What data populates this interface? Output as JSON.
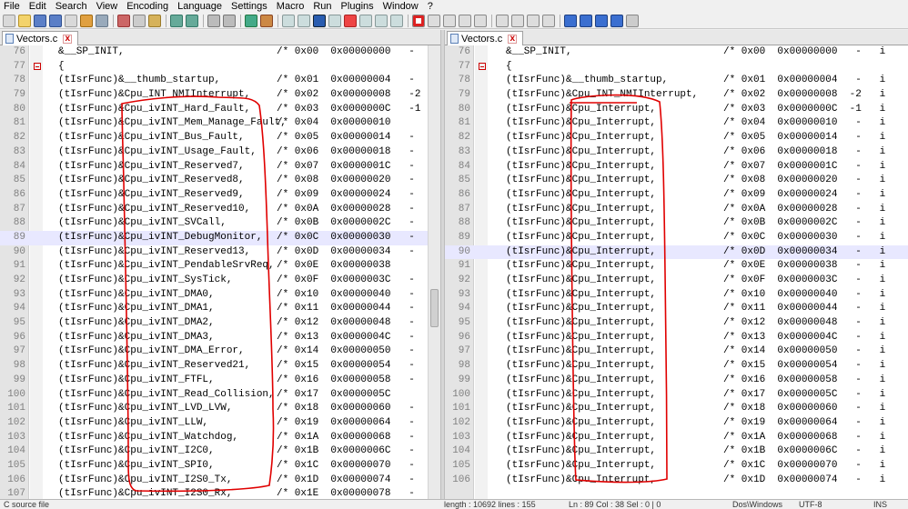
{
  "menu": [
    "File",
    "Edit",
    "Search",
    "View",
    "Encoding",
    "Language",
    "Settings",
    "Macro",
    "Run",
    "Plugins",
    "Window",
    "?"
  ],
  "tabs": {
    "left": "Vectors.c",
    "right": "Vectors.c"
  },
  "left_lines": [
    {
      "n": "76",
      "fold": false,
      "hl": false,
      "pre": "&__SP_INIT,",
      "cm": "/* 0x00  0x00000000   -"
    },
    {
      "n": "77",
      "fold": true,
      "hl": false,
      "pre": "{",
      "cm": ""
    },
    {
      "n": "78",
      "fold": false,
      "hl": false,
      "pre": "(tIsrFunc)&__thumb_startup,",
      "cm": "/* 0x01  0x00000004   -"
    },
    {
      "n": "79",
      "fold": false,
      "hl": false,
      "pre": "(tIsrFunc)&Cpu_INT_NMIInterrupt,",
      "cm": "/* 0x02  0x00000008   -2"
    },
    {
      "n": "80",
      "fold": false,
      "hl": false,
      "pre": "(tIsrFunc)&Cpu_ivINT_Hard_Fault,",
      "cm": "/* 0x03  0x0000000C   -1"
    },
    {
      "n": "81",
      "fold": false,
      "hl": false,
      "pre": "(tIsrFunc)&Cpu_ivINT_Mem_Manage_Fault,",
      "cm": "/* 0x04  0x00000010"
    },
    {
      "n": "82",
      "fold": false,
      "hl": false,
      "pre": "(tIsrFunc)&Cpu_ivINT_Bus_Fault,",
      "cm": "/* 0x05  0x00000014   -"
    },
    {
      "n": "83",
      "fold": false,
      "hl": false,
      "pre": "(tIsrFunc)&Cpu_ivINT_Usage_Fault,",
      "cm": "/* 0x06  0x00000018   -"
    },
    {
      "n": "84",
      "fold": false,
      "hl": false,
      "pre": "(tIsrFunc)&Cpu_ivINT_Reserved7,",
      "cm": "/* 0x07  0x0000001C   -"
    },
    {
      "n": "85",
      "fold": false,
      "hl": false,
      "pre": "(tIsrFunc)&Cpu_ivINT_Reserved8,",
      "cm": "/* 0x08  0x00000020   -"
    },
    {
      "n": "86",
      "fold": false,
      "hl": false,
      "pre": "(tIsrFunc)&Cpu_ivINT_Reserved9,",
      "cm": "/* 0x09  0x00000024   -"
    },
    {
      "n": "87",
      "fold": false,
      "hl": false,
      "pre": "(tIsrFunc)&Cpu_ivINT_Reserved10,",
      "cm": "/* 0x0A  0x00000028   -"
    },
    {
      "n": "88",
      "fold": false,
      "hl": false,
      "pre": "(tIsrFunc)&Cpu_ivINT_SVCall,",
      "cm": "/* 0x0B  0x0000002C   -"
    },
    {
      "n": "89",
      "fold": false,
      "hl": true,
      "pre": "(tIsrFunc)&Cpu_ivINT_DebugMonitor,",
      "cm": "/* 0x0C  0x00000030   -"
    },
    {
      "n": "90",
      "fold": false,
      "hl": false,
      "pre": "(tIsrFunc)&Cpu_ivINT_Reserved13,",
      "cm": "/* 0x0D  0x00000034   -"
    },
    {
      "n": "91",
      "fold": false,
      "hl": false,
      "pre": "(tIsrFunc)&Cpu_ivINT_PendableSrvReq,",
      "cm": "/* 0x0E  0x00000038"
    },
    {
      "n": "92",
      "fold": false,
      "hl": false,
      "pre": "(tIsrFunc)&Cpu_ivINT_SysTick,",
      "cm": "/* 0x0F  0x0000003C   -"
    },
    {
      "n": "93",
      "fold": false,
      "hl": false,
      "pre": "(tIsrFunc)&Cpu_ivINT_DMA0,",
      "cm": "/* 0x10  0x00000040   -"
    },
    {
      "n": "94",
      "fold": false,
      "hl": false,
      "pre": "(tIsrFunc)&Cpu_ivINT_DMA1,",
      "cm": "/* 0x11  0x00000044   -"
    },
    {
      "n": "95",
      "fold": false,
      "hl": false,
      "pre": "(tIsrFunc)&Cpu_ivINT_DMA2,",
      "cm": "/* 0x12  0x00000048   -"
    },
    {
      "n": "96",
      "fold": false,
      "hl": false,
      "pre": "(tIsrFunc)&Cpu_ivINT_DMA3,",
      "cm": "/* 0x13  0x0000004C   -"
    },
    {
      "n": "97",
      "fold": false,
      "hl": false,
      "pre": "(tIsrFunc)&Cpu_ivINT_DMA_Error,",
      "cm": "/* 0x14  0x00000050   -"
    },
    {
      "n": "98",
      "fold": false,
      "hl": false,
      "pre": "(tIsrFunc)&Cpu_ivINT_Reserved21,",
      "cm": "/* 0x15  0x00000054   -"
    },
    {
      "n": "99",
      "fold": false,
      "hl": false,
      "pre": "(tIsrFunc)&Cpu_ivINT_FTFL,",
      "cm": "/* 0x16  0x00000058   -"
    },
    {
      "n": "100",
      "fold": false,
      "hl": false,
      "pre": "(tIsrFunc)&Cpu_ivINT_Read_Collision,",
      "cm": "/* 0x17  0x0000005C"
    },
    {
      "n": "101",
      "fold": false,
      "hl": false,
      "pre": "(tIsrFunc)&Cpu_ivINT_LVD_LVW,",
      "cm": "/* 0x18  0x00000060   -"
    },
    {
      "n": "102",
      "fold": false,
      "hl": false,
      "pre": "(tIsrFunc)&Cpu_ivINT_LLW,",
      "cm": "/* 0x19  0x00000064   -"
    },
    {
      "n": "103",
      "fold": false,
      "hl": false,
      "pre": "(tIsrFunc)&Cpu_ivINT_Watchdog,",
      "cm": "/* 0x1A  0x00000068   -"
    },
    {
      "n": "104",
      "fold": false,
      "hl": false,
      "pre": "(tIsrFunc)&Cpu_ivINT_I2C0,",
      "cm": "/* 0x1B  0x0000006C   -"
    },
    {
      "n": "105",
      "fold": false,
      "hl": false,
      "pre": "(tIsrFunc)&Cpu_ivINT_SPI0,",
      "cm": "/* 0x1C  0x00000070   -"
    },
    {
      "n": "106",
      "fold": false,
      "hl": false,
      "pre": "(tIsrFunc)&Cpu_ivINT_I2S0_Tx,",
      "cm": "/* 0x1D  0x00000074   -"
    },
    {
      "n": "107",
      "fold": false,
      "hl": false,
      "pre": "(tIsrFunc)&Cpu_ivINT_I2S0_Rx,",
      "cm": "/* 0x1E  0x00000078   -"
    }
  ],
  "right_lines": [
    {
      "n": "76",
      "fold": false,
      "hl": false,
      "pre": "&__SP_INIT,",
      "cm": "/* 0x00  0x00000000   -   i"
    },
    {
      "n": "77",
      "fold": true,
      "hl": false,
      "pre": "{",
      "cm": ""
    },
    {
      "n": "78",
      "fold": false,
      "hl": false,
      "pre": "(tIsrFunc)&__thumb_startup,",
      "cm": "/* 0x01  0x00000004   -   i"
    },
    {
      "n": "79",
      "fold": false,
      "hl": false,
      "pre": "(tIsrFunc)&Cpu_INT_NMIInterrupt,",
      "cm": "/* 0x02  0x00000008  -2   i"
    },
    {
      "n": "80",
      "fold": false,
      "hl": false,
      "pre": "(tIsrFunc)&Cpu_Interrupt,",
      "cm": "/* 0x03  0x0000000C  -1   i"
    },
    {
      "n": "81",
      "fold": false,
      "hl": false,
      "pre": "(tIsrFunc)&Cpu_Interrupt,",
      "cm": "/* 0x04  0x00000010   -   i"
    },
    {
      "n": "82",
      "fold": false,
      "hl": false,
      "pre": "(tIsrFunc)&Cpu_Interrupt,",
      "cm": "/* 0x05  0x00000014   -   i"
    },
    {
      "n": "83",
      "fold": false,
      "hl": false,
      "pre": "(tIsrFunc)&Cpu_Interrupt,",
      "cm": "/* 0x06  0x00000018   -   i"
    },
    {
      "n": "84",
      "fold": false,
      "hl": false,
      "pre": "(tIsrFunc)&Cpu_Interrupt,",
      "cm": "/* 0x07  0x0000001C   -   i"
    },
    {
      "n": "85",
      "fold": false,
      "hl": false,
      "pre": "(tIsrFunc)&Cpu_Interrupt,",
      "cm": "/* 0x08  0x00000020   -   i"
    },
    {
      "n": "86",
      "fold": false,
      "hl": false,
      "pre": "(tIsrFunc)&Cpu_Interrupt,",
      "cm": "/* 0x09  0x00000024   -   i"
    },
    {
      "n": "87",
      "fold": false,
      "hl": false,
      "pre": "(tIsrFunc)&Cpu_Interrupt,",
      "cm": "/* 0x0A  0x00000028   -   i"
    },
    {
      "n": "88",
      "fold": false,
      "hl": false,
      "pre": "(tIsrFunc)&Cpu_Interrupt,",
      "cm": "/* 0x0B  0x0000002C   -   i"
    },
    {
      "n": "89",
      "fold": false,
      "hl": false,
      "pre": "(tIsrFunc)&Cpu_Interrupt,",
      "cm": "/* 0x0C  0x00000030   -   i"
    },
    {
      "n": "90",
      "fold": false,
      "hl": true,
      "pre": "(tIsrFunc)&Cpu_Interrupt,",
      "cm": "/* 0x0D  0x00000034   -   i"
    },
    {
      "n": "91",
      "fold": false,
      "hl": false,
      "pre": "(tIsrFunc)&Cpu_Interrupt,",
      "cm": "/* 0x0E  0x00000038   -   i"
    },
    {
      "n": "92",
      "fold": false,
      "hl": false,
      "pre": "(tIsrFunc)&Cpu_Interrupt,",
      "cm": "/* 0x0F  0x0000003C   -   i"
    },
    {
      "n": "93",
      "fold": false,
      "hl": false,
      "pre": "(tIsrFunc)&Cpu_Interrupt,",
      "cm": "/* 0x10  0x00000040   -   i"
    },
    {
      "n": "94",
      "fold": false,
      "hl": false,
      "pre": "(tIsrFunc)&Cpu_Interrupt,",
      "cm": "/* 0x11  0x00000044   -   i"
    },
    {
      "n": "95",
      "fold": false,
      "hl": false,
      "pre": "(tIsrFunc)&Cpu_Interrupt,",
      "cm": "/* 0x12  0x00000048   -   i"
    },
    {
      "n": "96",
      "fold": false,
      "hl": false,
      "pre": "(tIsrFunc)&Cpu_Interrupt,",
      "cm": "/* 0x13  0x0000004C   -   i"
    },
    {
      "n": "97",
      "fold": false,
      "hl": false,
      "pre": "(tIsrFunc)&Cpu_Interrupt,",
      "cm": "/* 0x14  0x00000050   -   i"
    },
    {
      "n": "98",
      "fold": false,
      "hl": false,
      "pre": "(tIsrFunc)&Cpu_Interrupt,",
      "cm": "/* 0x15  0x00000054   -   i"
    },
    {
      "n": "99",
      "fold": false,
      "hl": false,
      "pre": "(tIsrFunc)&Cpu_Interrupt,",
      "cm": "/* 0x16  0x00000058   -   i"
    },
    {
      "n": "100",
      "fold": false,
      "hl": false,
      "pre": "(tIsrFunc)&Cpu_Interrupt,",
      "cm": "/* 0x17  0x0000005C   -   i"
    },
    {
      "n": "101",
      "fold": false,
      "hl": false,
      "pre": "(tIsrFunc)&Cpu_Interrupt,",
      "cm": "/* 0x18  0x00000060   -   i"
    },
    {
      "n": "102",
      "fold": false,
      "hl": false,
      "pre": "(tIsrFunc)&Cpu_Interrupt,",
      "cm": "/* 0x19  0x00000064   -   i"
    },
    {
      "n": "103",
      "fold": false,
      "hl": false,
      "pre": "(tIsrFunc)&Cpu_Interrupt,",
      "cm": "/* 0x1A  0x00000068   -   i"
    },
    {
      "n": "104",
      "fold": false,
      "hl": false,
      "pre": "(tIsrFunc)&Cpu_Interrupt,",
      "cm": "/* 0x1B  0x0000006C   -   i"
    },
    {
      "n": "105",
      "fold": false,
      "hl": false,
      "pre": "(tIsrFunc)&Cpu_Interrupt,",
      "cm": "/* 0x1C  0x00000070   -   i"
    },
    {
      "n": "106",
      "fold": false,
      "hl": false,
      "pre": "(tIsrFunc)&Cpu_Interrupt,",
      "cm": "/* 0x1D  0x00000074   -   i"
    }
  ],
  "status": {
    "type": "C source file",
    "length": "length : 10692    lines : 155",
    "pos": "Ln : 89    Col : 38    Sel : 0 | 0",
    "eol": "Dos\\Windows",
    "enc": "UTF-8",
    "mode": "INS"
  },
  "colors": {
    "annotation": "#e00000",
    "comment": "#008000",
    "highlight": "#e8e8ff"
  }
}
